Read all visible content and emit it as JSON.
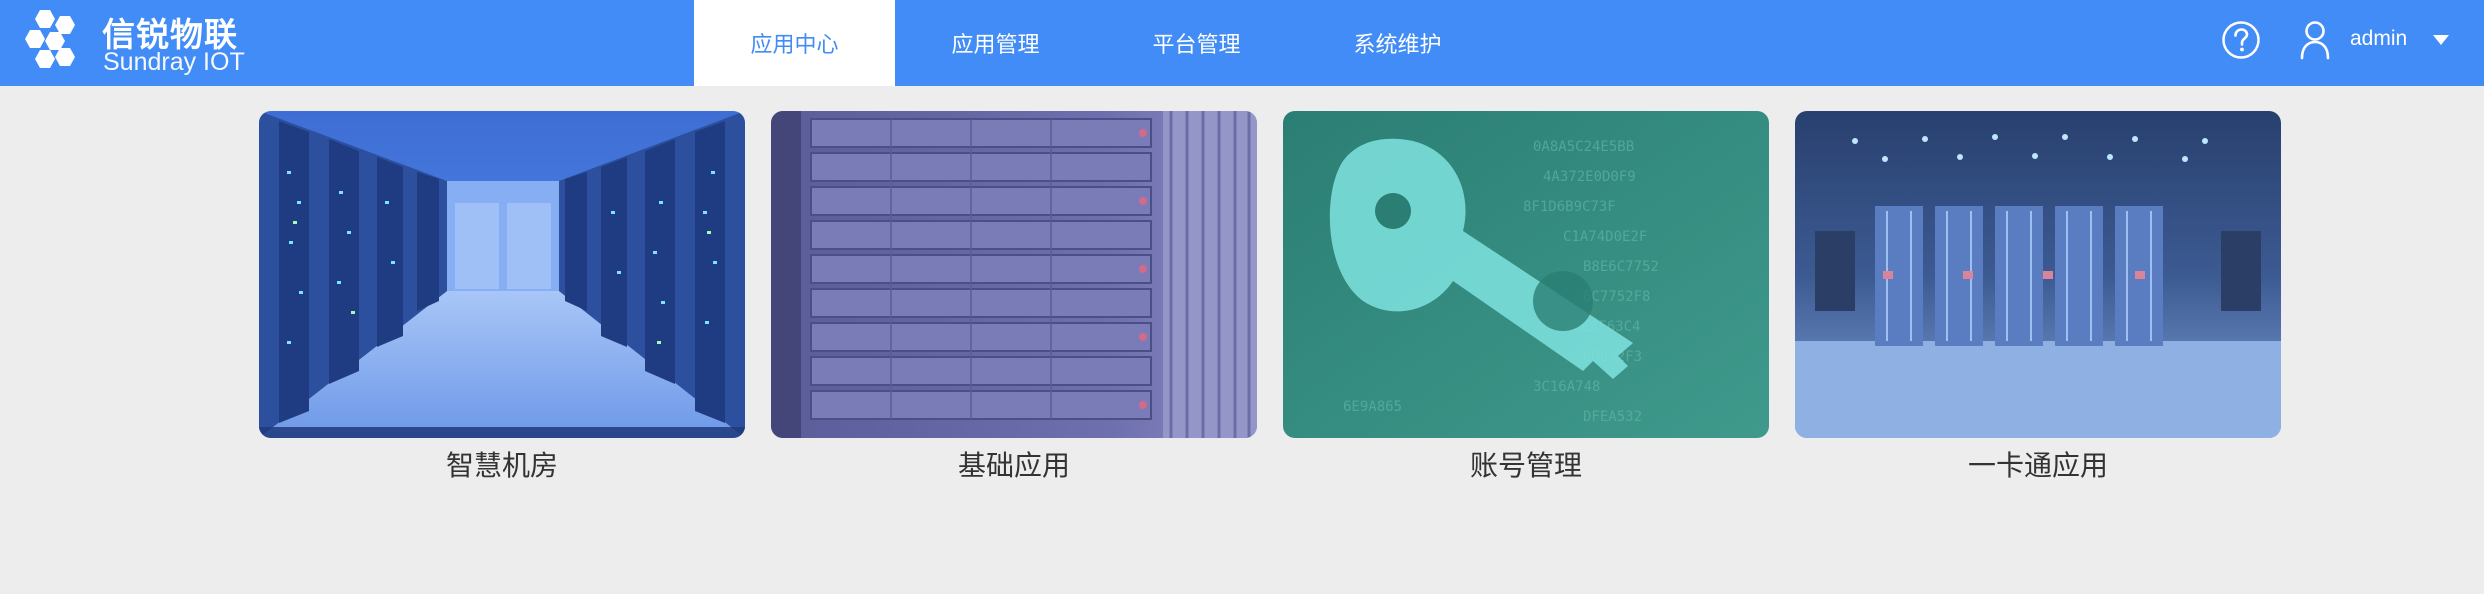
{
  "brand": {
    "name_cn": "信锐物联",
    "name_en": "Sundray IOT"
  },
  "nav": {
    "tabs": [
      {
        "label": "应用中心",
        "active": true
      },
      {
        "label": "应用管理",
        "active": false
      },
      {
        "label": "平台管理",
        "active": false
      },
      {
        "label": "系统维护",
        "active": false
      }
    ]
  },
  "user": {
    "help_icon": "question-circle-icon",
    "user_icon": "user-icon",
    "name": "admin",
    "menu_icon": "caret-down-icon"
  },
  "apps": [
    {
      "label": "智慧机房",
      "image": "server-room-corridor"
    },
    {
      "label": "基础应用",
      "image": "server-rack-closeup"
    },
    {
      "label": "账号管理",
      "image": "digital-key"
    },
    {
      "label": "一卡通应用",
      "image": "server-cabinets-hall"
    }
  ],
  "colors": {
    "header": "#418cf6",
    "background": "#ededed",
    "active_tab_text": "#418cf6"
  }
}
